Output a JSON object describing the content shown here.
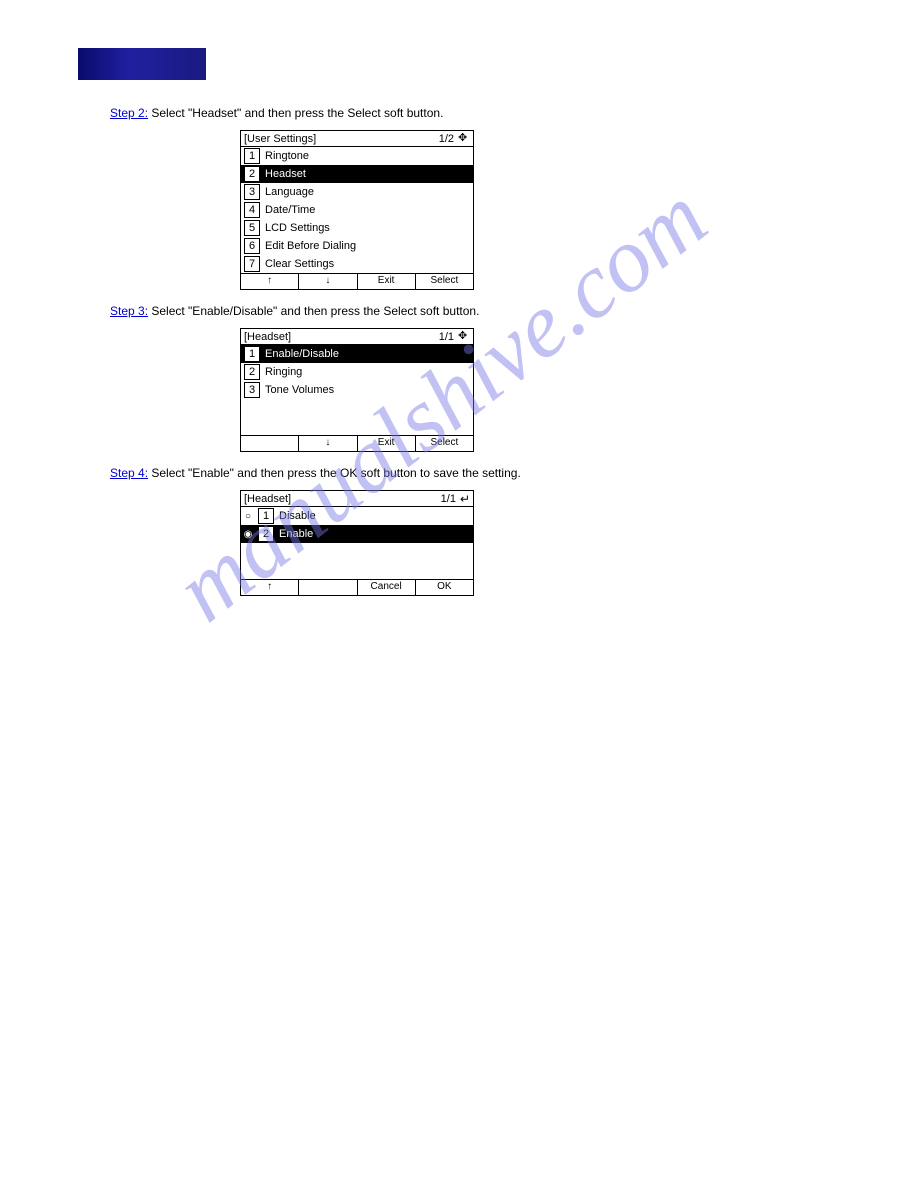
{
  "watermark": "manualshive.com",
  "step2": {
    "label": "Step 2:",
    "text": " Select \"Headset\" and then press the Select soft button."
  },
  "lcd1": {
    "title": "[User Settings]",
    "page": "1/2",
    "rows": [
      {
        "n": "1",
        "label": "Ringtone",
        "selected": false
      },
      {
        "n": "2",
        "label": "Headset",
        "selected": true
      },
      {
        "n": "3",
        "label": "Language",
        "selected": false
      },
      {
        "n": "4",
        "label": "Date/Time",
        "selected": false
      },
      {
        "n": "5",
        "label": "LCD Settings",
        "selected": false
      },
      {
        "n": "6",
        "label": "Edit Before Dialing",
        "selected": false
      },
      {
        "n": "7",
        "label": "Clear Settings",
        "selected": false
      }
    ],
    "softkeys": [
      "↑",
      "↓",
      "Exit",
      "Select"
    ]
  },
  "step3": {
    "label": "Step 3:",
    "text": " Select \"Enable/Disable\" and then press the Select soft button."
  },
  "lcd2": {
    "title": "[Headset]",
    "page": "1/1",
    "rows": [
      {
        "n": "1",
        "label": "Enable/Disable",
        "selected": true
      },
      {
        "n": "2",
        "label": "Ringing",
        "selected": false
      },
      {
        "n": "3",
        "label": "Tone Volumes",
        "selected": false
      }
    ],
    "softkeys": [
      "",
      "↓",
      "Exit",
      "Select"
    ]
  },
  "step4": {
    "label": "Step 4:",
    "text": " Select \"Enable\" and then press the OK soft button to save the setting."
  },
  "lcd3": {
    "title": "[Headset]",
    "page": "1/1",
    "radios": [
      {
        "n": "1",
        "label": "Disable",
        "selected": false,
        "checked": false
      },
      {
        "n": "2",
        "label": "Enable",
        "selected": true,
        "checked": true
      }
    ],
    "softkeys": [
      "↑",
      "",
      "Cancel",
      "OK"
    ]
  }
}
